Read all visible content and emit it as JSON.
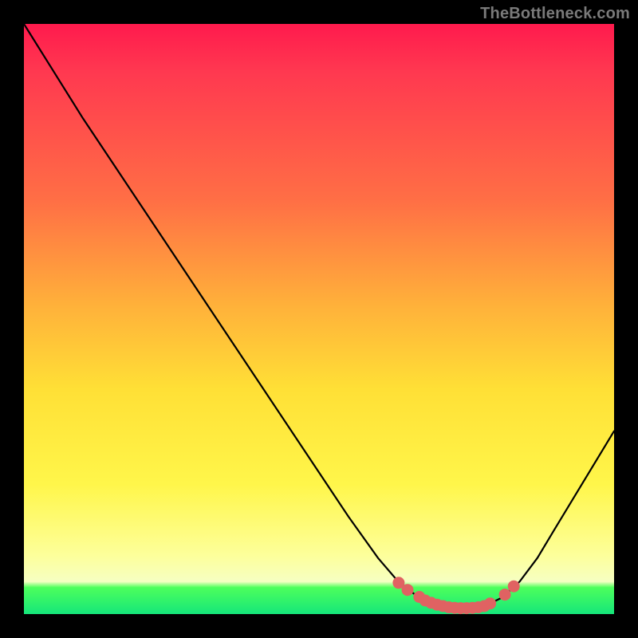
{
  "watermark": "TheBottleneck.com",
  "chart_data": {
    "type": "line",
    "title": "",
    "xlabel": "",
    "ylabel": "",
    "xlim": [
      0,
      100
    ],
    "ylim": [
      0,
      100
    ],
    "grid": false,
    "colors": {
      "gradient_top": "#ff1a4d",
      "gradient_mid": "#ffe036",
      "gradient_bottom_green": "#15e67a",
      "curve": "#000000",
      "markers": "#e06262"
    },
    "series": [
      {
        "name": "bottleneck-curve",
        "x": [
          0,
          5,
          10,
          20,
          30,
          40,
          50,
          55,
          60,
          63,
          66,
          69,
          72,
          75,
          78,
          81,
          84,
          87,
          90,
          100
        ],
        "values": [
          100,
          92,
          84,
          69,
          54,
          39,
          24,
          16.5,
          9.5,
          6.0,
          3.5,
          1.8,
          1.0,
          1.0,
          1.3,
          2.8,
          5.5,
          9.5,
          14.5,
          31
        ]
      }
    ],
    "markers": [
      {
        "x": 63.5,
        "y": 5.3
      },
      {
        "x": 65.0,
        "y": 4.1
      },
      {
        "x": 67.0,
        "y": 2.9
      },
      {
        "x": 68.0,
        "y": 2.3
      },
      {
        "x": 69.0,
        "y": 1.9
      },
      {
        "x": 70.0,
        "y": 1.6
      },
      {
        "x": 71.0,
        "y": 1.35
      },
      {
        "x": 72.0,
        "y": 1.15
      },
      {
        "x": 73.0,
        "y": 1.05
      },
      {
        "x": 74.0,
        "y": 1.0
      },
      {
        "x": 75.0,
        "y": 1.0
      },
      {
        "x": 76.0,
        "y": 1.05
      },
      {
        "x": 77.0,
        "y": 1.15
      },
      {
        "x": 78.0,
        "y": 1.35
      },
      {
        "x": 79.0,
        "y": 1.8
      },
      {
        "x": 81.5,
        "y": 3.3
      },
      {
        "x": 83.0,
        "y": 4.7
      }
    ]
  }
}
